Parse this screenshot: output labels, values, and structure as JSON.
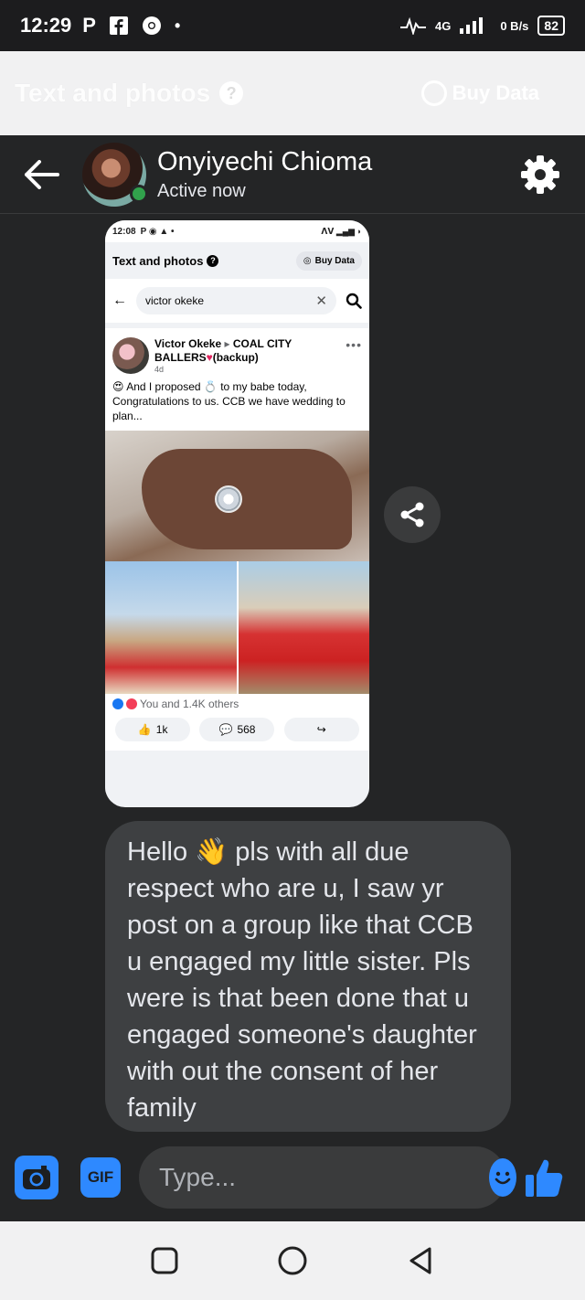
{
  "status_bar": {
    "time": "12:29",
    "icons": [
      "p-icon",
      "facebook-icon",
      "chrome-icon",
      "dot-icon"
    ],
    "network": "4G",
    "data_rate": "0 B/s",
    "battery": "82"
  },
  "banner": {
    "title": "Text and photos",
    "buy_data_label": "Buy Data"
  },
  "header": {
    "name": "Onyiyechi Chioma",
    "status": "Active now"
  },
  "shared_screenshot": {
    "status_time": "12:08",
    "page_title": "Text and photos",
    "buy_data_label": "Buy Data",
    "search_value": "victor okeke",
    "post": {
      "author": "Victor Okeke",
      "group": "COAL CITY BALLERS",
      "group_suffix": "(backup)",
      "time": "4d",
      "text": "And I proposed 💍 to my babe today, Congratulations to us. CCB we have wedding to plan...",
      "reactions": "You and 1.4K others",
      "likes": "1k",
      "comments": "568"
    }
  },
  "message": {
    "text": "Hello 👋 pls with all due respect who are u, I saw yr post on a group like that CCB u engaged my little sister. Pls were is that been done that u engaged someone's daughter with out the consent of her family"
  },
  "composer": {
    "gif_label": "GIF",
    "placeholder": "Type..."
  },
  "colors": {
    "accent": "#2e89ff",
    "online": "#31a24c",
    "background": "#242526",
    "bubble": "#3e4042"
  }
}
